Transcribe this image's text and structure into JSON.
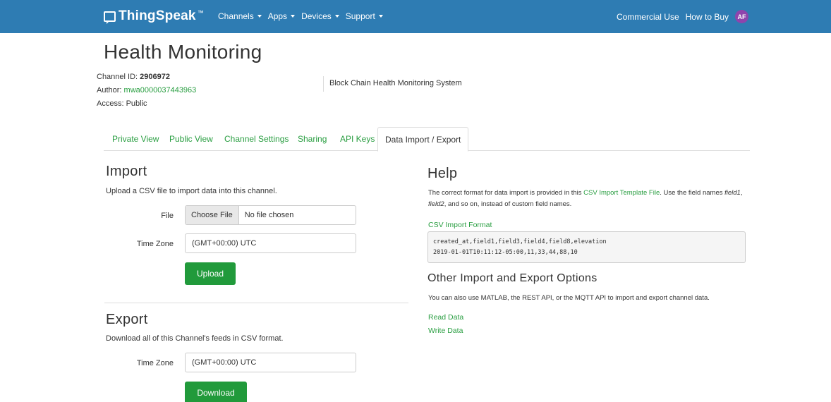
{
  "navbar": {
    "brand": "ThingSpeak",
    "brand_tm": "™",
    "menu": [
      "Channels",
      "Apps",
      "Devices",
      "Support"
    ],
    "commercial_use": "Commercial Use",
    "how_to_buy": "How to Buy",
    "avatar_initials": "AF",
    "colors": {
      "bar": "#2e7cb3",
      "avatar": "#8e44ad"
    }
  },
  "header": {
    "title": "Health Monitoring",
    "channel_id_label": "Channel ID:",
    "channel_id": "2906972",
    "author_label": "Author:",
    "author": "mwa0000037443963",
    "access": "Access: Public",
    "description": "Block Chain Health Monitoring System"
  },
  "tabs": [
    "Private View",
    "Public View",
    "Channel Settings",
    "Sharing",
    "API Keys",
    "Data Import / Export"
  ],
  "active_tab": "Data Import / Export",
  "import": {
    "heading": "Import",
    "subtitle": "Upload a CSV file to import data into this channel.",
    "file_label": "File",
    "choose_file": "Choose File",
    "no_file": "No file chosen",
    "timezone_label": "Time Zone",
    "timezone_value": "(GMT+00:00) UTC",
    "upload_button": "Upload"
  },
  "export": {
    "heading": "Export",
    "subtitle": "Download all of this Channel's feeds in CSV format.",
    "timezone_label": "Time Zone",
    "timezone_value": "(GMT+00:00) UTC",
    "download_button": "Download"
  },
  "help": {
    "heading": "Help",
    "text_1": "The correct format for data import is provided in this ",
    "template_link": "CSV Import Template File",
    "text_2": ". Use the field names ",
    "field1": "field1",
    "comma": ", ",
    "field2": "field2",
    "text_3": ", and so on, instead of custom field names.",
    "csv_format_label": "CSV Import Format",
    "code_line1": "created_at,field1,field3,field4,field8,elevation",
    "code_line2": "2019-01-01T10:11:12-05:00,11,33,44,88,10",
    "other_heading": "Other Import and Export Options",
    "other_text": "You can also use MATLAB, the REST API, or the MQTT API to import and export channel data.",
    "read_data": "Read Data",
    "write_data": "Write Data"
  }
}
